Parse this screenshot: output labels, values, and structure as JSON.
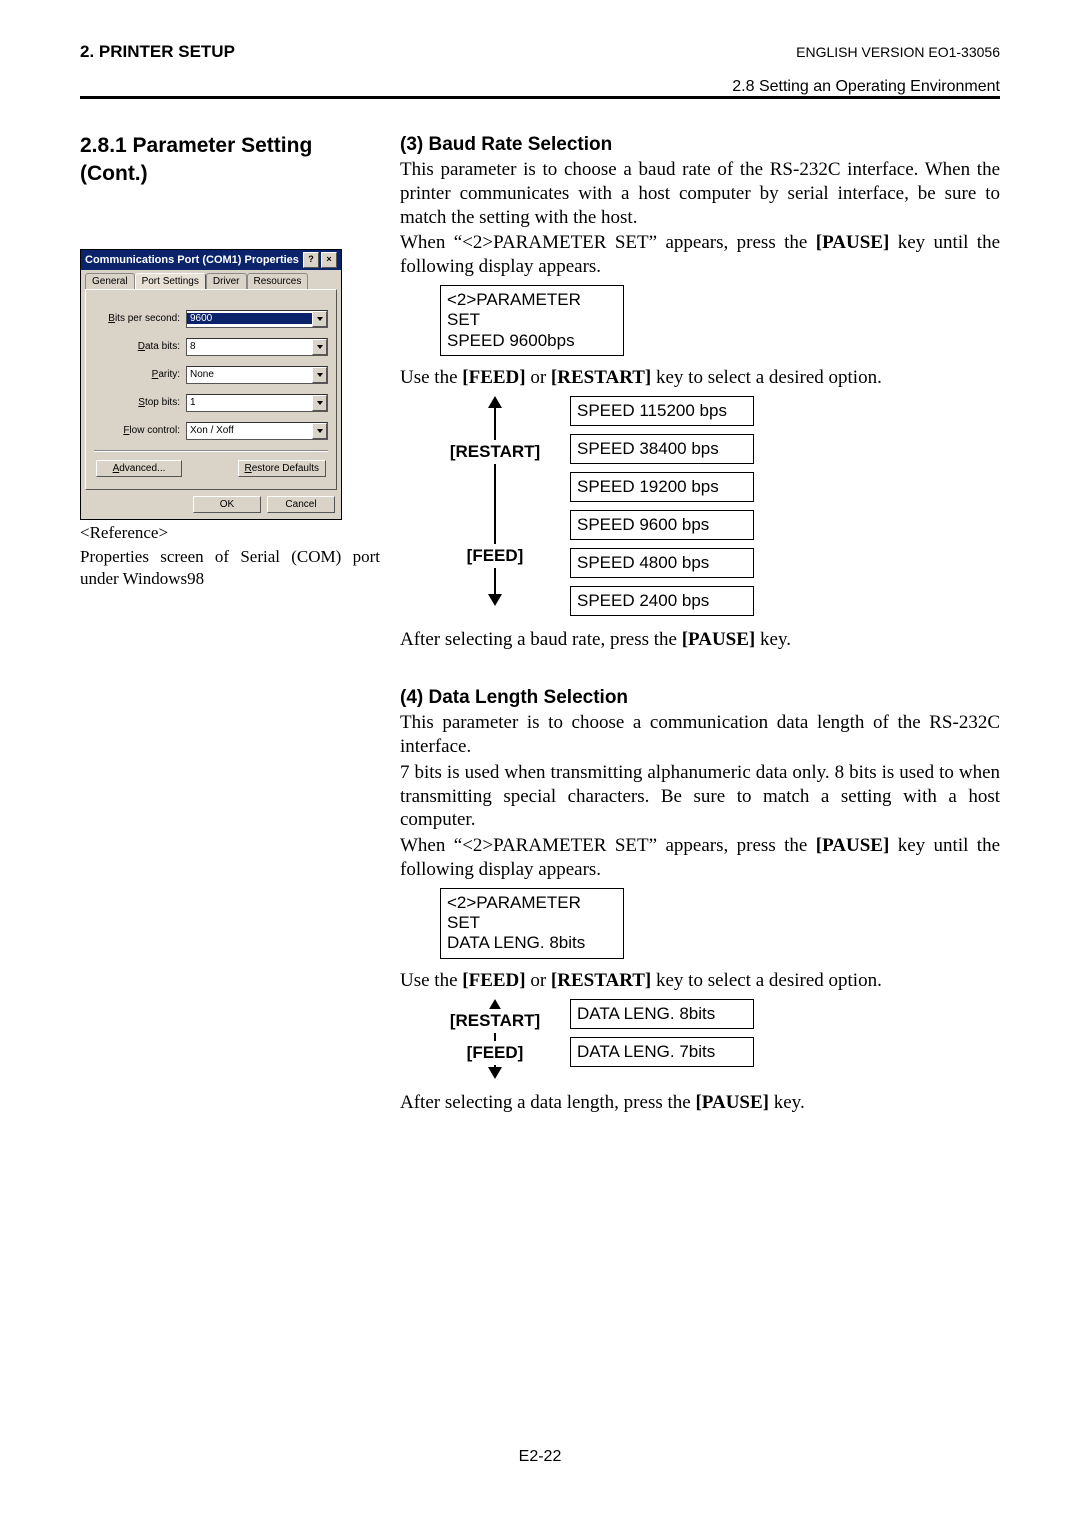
{
  "header": {
    "left": "2. PRINTER SETUP",
    "right": "ENGLISH VERSION EO1-33056",
    "section": "2.8 Setting an Operating Environment"
  },
  "left": {
    "sectionTitle": "2.8.1  Parameter Setting (Cont.)",
    "w98": {
      "title": "Communications Port (COM1) Properties",
      "tabs": [
        "General",
        "Port Settings",
        "Driver",
        "Resources"
      ],
      "fields": {
        "bps": {
          "label_pre": "B",
          "label": "its per second:",
          "value": "9600"
        },
        "data": {
          "label_pre": "D",
          "label": "ata bits:",
          "value": "8"
        },
        "parity": {
          "label_pre": "P",
          "label": "arity:",
          "value": "None"
        },
        "stop": {
          "label_pre": "S",
          "label": "top bits:",
          "value": "1"
        },
        "flow": {
          "label_pre": "F",
          "label": "low control:",
          "value": "Xon / Xoff"
        }
      },
      "advanced_pre": "A",
      "advanced": "dvanced...",
      "restore_pre": "R",
      "restore": "estore Defaults",
      "ok": "OK",
      "cancel": "Cancel"
    },
    "ref1": "<Reference>",
    "ref2": "Properties screen of Serial (COM) port under Windows98"
  },
  "s3": {
    "title": "(3)  Baud Rate Selection",
    "p1": "This parameter is to choose a baud rate of the RS-232C interface.  When the printer communicates with a host computer by serial interface, be sure to match the setting with the host.",
    "p2a": "When “<2>PARAMETER SET” appears, press the ",
    "p2b": " key until the following display appears.",
    "pause": "[PAUSE]",
    "lcd1": "<2>PARAMETER SET",
    "lcd2": "SPEED  9600bps",
    "p3a": "Use the ",
    "feed": "[FEED]",
    "or": " or ",
    "restart": "[RESTART]",
    "p3b": " key to select a desired option.",
    "labels": {
      "restart": "[RESTART]",
      "feed": "[FEED]"
    },
    "opts": [
      "SPEED  115200 bps",
      "SPEED  38400 bps",
      "SPEED  19200 bps",
      "SPEED   9600 bps",
      "SPEED   4800 bps",
      "SPEED   2400 bps"
    ],
    "p4a": "After selecting a baud rate, press the ",
    "p4b": " key."
  },
  "s4": {
    "title": "(4)  Data Length Selection",
    "p1": "This parameter is to choose a communication data length of the RS-232C interface.",
    "p2": "7 bits is used when transmitting alphanumeric data only.  8 bits is used to when transmitting special characters.  Be sure to match a setting with a host computer.",
    "p3a": "When “<2>PARAMETER SET” appears, press the ",
    "p3b": " key until the following display appears.",
    "pause": "[PAUSE]",
    "lcd1": "<2>PARAMETER SET",
    "lcd2": "DATA LENG. 8bits",
    "p4a": "Use the ",
    "feed": "[FEED]",
    "or": " or ",
    "restart": "[RESTART]",
    "p4b": " key to select a desired option.",
    "labels": {
      "restart": "[RESTART]",
      "feed": "[FEED]"
    },
    "opts": [
      "DATA LENG. 8bits",
      "DATA LENG. 7bits"
    ],
    "p5a": "After selecting a data length, press the ",
    "p5b": " key."
  },
  "pageNumber": "E2-22"
}
